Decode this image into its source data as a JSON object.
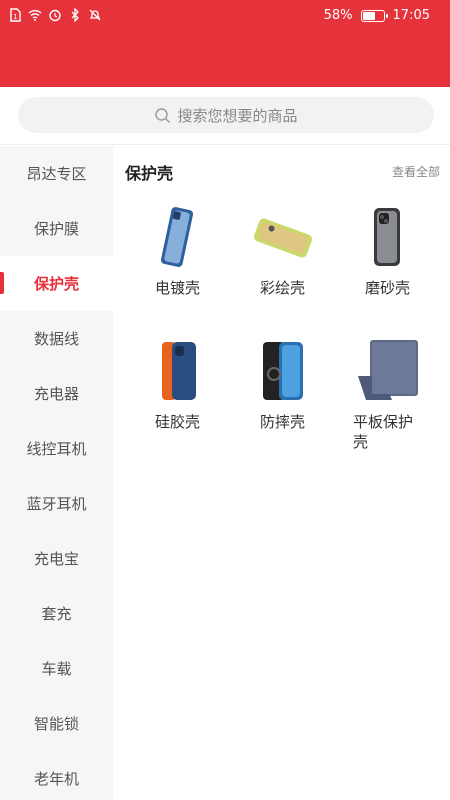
{
  "status": {
    "battery": "58%",
    "time": "17:05",
    "battery_level": 0.58
  },
  "search": {
    "placeholder": "搜索您想要的商品"
  },
  "sidebar": {
    "items": [
      {
        "label": "昂达专区"
      },
      {
        "label": "保护膜"
      },
      {
        "label": "保护壳",
        "active": true
      },
      {
        "label": "数据线"
      },
      {
        "label": "充电器"
      },
      {
        "label": "线控耳机"
      },
      {
        "label": "蓝牙耳机"
      },
      {
        "label": "充电宝"
      },
      {
        "label": "套充"
      },
      {
        "label": "车载"
      },
      {
        "label": "智能锁"
      },
      {
        "label": "老年机"
      }
    ]
  },
  "main": {
    "title": "保护壳",
    "view_all": "查看全部",
    "products": [
      {
        "label": "电镀壳",
        "icon": "electroplated-case-icon"
      },
      {
        "label": "彩绘壳",
        "icon": "painted-case-icon"
      },
      {
        "label": "磨砂壳",
        "icon": "frosted-case-icon"
      },
      {
        "label": "硅胶壳",
        "icon": "silicone-case-icon"
      },
      {
        "label": "防摔壳",
        "icon": "shockproof-case-icon"
      },
      {
        "label": "平板保护壳",
        "icon": "tablet-case-icon"
      }
    ]
  },
  "colors": {
    "accent": "#e5323b",
    "sidebar_bg": "#f6f6f6"
  }
}
